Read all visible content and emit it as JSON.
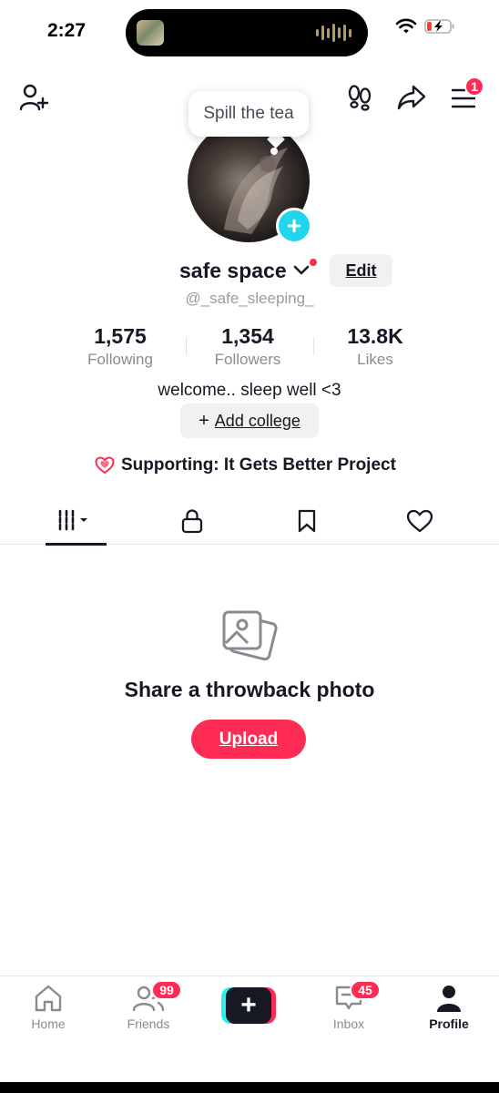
{
  "status_bar": {
    "time": "2:27"
  },
  "header": {
    "menu_badge": "1"
  },
  "tooltip": {
    "text": "Spill the tea"
  },
  "profile": {
    "display_name": "safe space",
    "edit_label": "Edit",
    "username": "@_safe_sleeping_",
    "stats": [
      {
        "value": "1,575",
        "label": "Following"
      },
      {
        "value": "1,354",
        "label": "Followers"
      },
      {
        "value": "13.8K",
        "label": "Likes"
      }
    ],
    "bio": "welcome.. sleep well <3",
    "add_college_plus": "+",
    "add_college_label": "Add college",
    "supporting": "Supporting: It Gets Better Project"
  },
  "tabs": [
    {
      "name": "videos-grid",
      "icon": "grid-icon",
      "active": true
    },
    {
      "name": "private",
      "icon": "lock-icon"
    },
    {
      "name": "favorites",
      "icon": "bookmark-icon"
    },
    {
      "name": "liked",
      "icon": "heart-icon"
    }
  ],
  "empty_state": {
    "title": "Share a throwback photo",
    "button": "Upload"
  },
  "bottom_nav": {
    "items": [
      {
        "label": "Home",
        "icon": "home-icon"
      },
      {
        "label": "Friends",
        "icon": "friends-icon",
        "badge": "99"
      },
      {
        "label": "",
        "icon": "create-plus-icon"
      },
      {
        "label": "Inbox",
        "icon": "inbox-icon",
        "badge": "45"
      },
      {
        "label": "Profile",
        "icon": "profile-icon",
        "active": true
      }
    ]
  },
  "colors": {
    "accent": "#fe2c55",
    "cyan": "#20d5ec",
    "text": "#161823",
    "muted": "#8a8b91"
  }
}
